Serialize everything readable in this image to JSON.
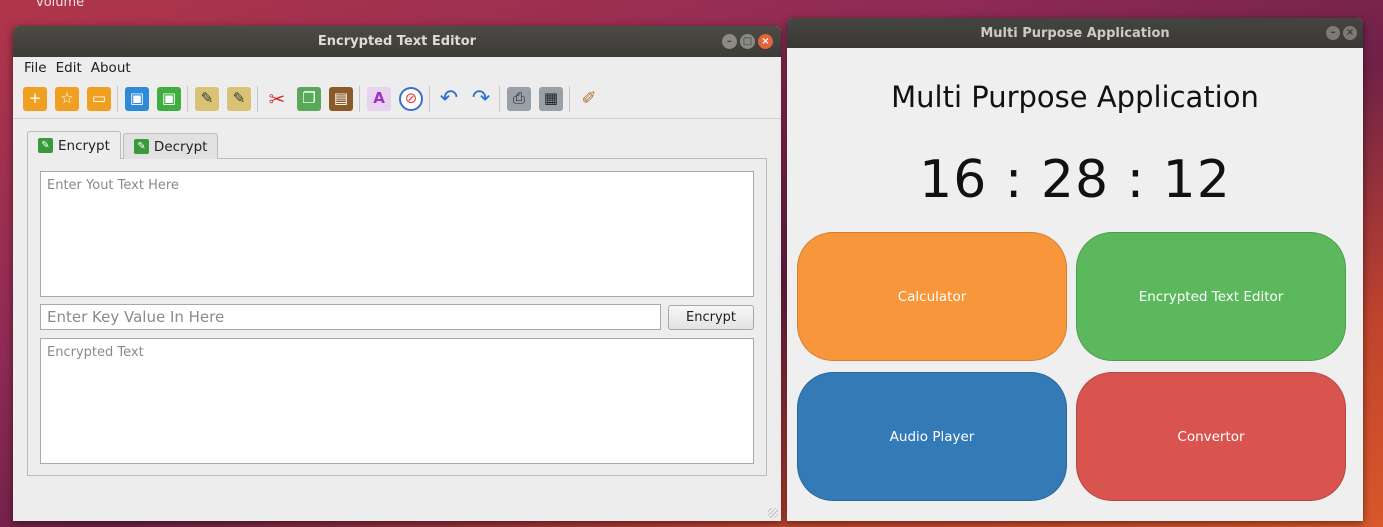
{
  "desktop": {
    "label": "volume"
  },
  "editor_window": {
    "title": "Encrypted Text Editor",
    "menu": [
      "File",
      "Edit",
      "About"
    ],
    "toolbar_icons": [
      "new-folder-icon",
      "favorite-folder-icon",
      "open-folder-icon",
      "save-icon",
      "save-as-icon",
      "encrypt-file-icon",
      "decrypt-file-icon",
      "cut-icon",
      "copy-icon",
      "paste-icon",
      "font-icon",
      "color-icon",
      "undo-icon",
      "redo-icon",
      "print-icon",
      "print-preview-icon",
      "clear-icon"
    ],
    "tabs": [
      "Encrypt",
      "Decrypt"
    ],
    "input_placeholder": "Enter Yout Text Here",
    "key_placeholder": "Enter Key Value In Here",
    "encrypt_button": "Encrypt",
    "output_placeholder": "Encrypted Text"
  },
  "app_window": {
    "title": "Multi Purpose Application",
    "heading": "Multi Purpose Application",
    "clock": "16 : 28 : 12",
    "tiles": [
      {
        "label": "Calculator",
        "color": "#f7963a"
      },
      {
        "label": "Encrypted Text Editor",
        "color": "#5cb85c"
      },
      {
        "label": "Audio Player",
        "color": "#337ab7"
      },
      {
        "label": "Convertor",
        "color": "#d9534f"
      }
    ]
  }
}
